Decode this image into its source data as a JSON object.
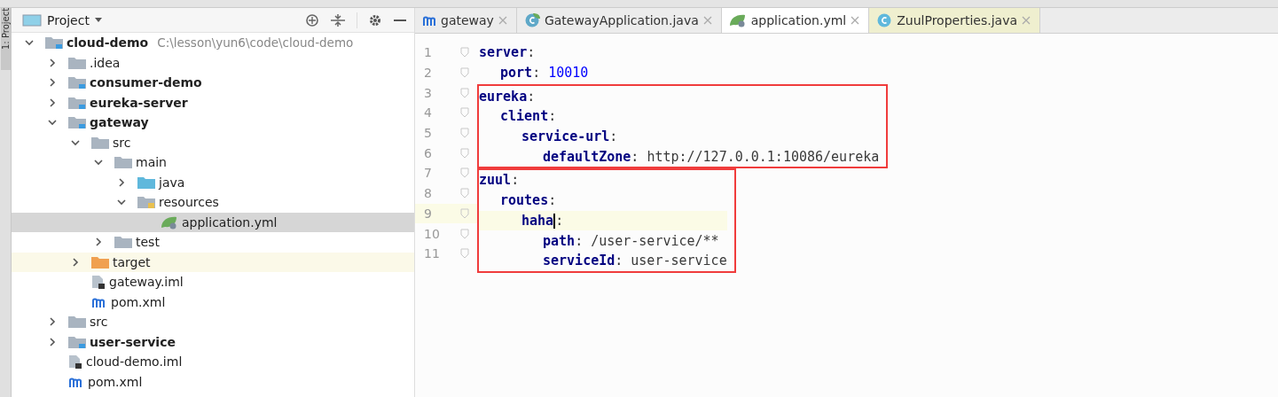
{
  "side_strip": {
    "label": "1: Project"
  },
  "project_panel": {
    "title": "Project",
    "tree": [
      {
        "label": "cloud-demo",
        "path": "C:\\lesson\\yun6\\code\\cloud-demo",
        "kind": "module",
        "expanded": true,
        "selected": false,
        "children": [
          {
            "label": ".idea",
            "kind": "folder",
            "expanded": false,
            "selected": false
          },
          {
            "label": "consumer-demo",
            "kind": "module",
            "expanded": false,
            "selected": false
          },
          {
            "label": "eureka-server",
            "kind": "module",
            "expanded": false,
            "selected": false
          },
          {
            "label": "gateway",
            "kind": "module",
            "expanded": true,
            "selected": false,
            "children": [
              {
                "label": "src",
                "kind": "folder",
                "expanded": true,
                "selected": false,
                "children": [
                  {
                    "label": "main",
                    "kind": "folder",
                    "expanded": true,
                    "selected": false,
                    "children": [
                      {
                        "label": "java",
                        "kind": "source-folder",
                        "expanded": false,
                        "selected": false
                      },
                      {
                        "label": "resources",
                        "kind": "resources-folder",
                        "expanded": true,
                        "selected": false,
                        "children": [
                          {
                            "label": "application.yml",
                            "kind": "spring-file",
                            "selected": true
                          }
                        ]
                      }
                    ]
                  },
                  {
                    "label": "test",
                    "kind": "folder",
                    "expanded": false,
                    "selected": false
                  }
                ]
              },
              {
                "label": "target",
                "kind": "excluded-folder",
                "expanded": false,
                "selected": false
              },
              {
                "label": "gateway.iml",
                "kind": "iml-file",
                "selected": false
              },
              {
                "label": "pom.xml",
                "kind": "maven-file",
                "selected": false
              }
            ]
          },
          {
            "label": "src",
            "kind": "folder",
            "expanded": false,
            "selected": false
          },
          {
            "label": "user-service",
            "kind": "module",
            "expanded": false,
            "selected": false
          },
          {
            "label": "cloud-demo.iml",
            "kind": "iml-file",
            "selected": false
          },
          {
            "label": "pom.xml",
            "kind": "maven-file",
            "selected": false
          }
        ]
      }
    ]
  },
  "editor": {
    "tabs": [
      {
        "label": "gateway",
        "kind": "maven",
        "selected": false
      },
      {
        "label": "GatewayApplication.java",
        "kind": "spring-class",
        "selected": false
      },
      {
        "label": "application.yml",
        "kind": "spring-file",
        "selected": true
      },
      {
        "label": "ZuulProperties.java",
        "kind": "library-class",
        "selected": false
      }
    ],
    "code": [
      {
        "number": "1",
        "key": "server",
        "sep": ":",
        "boxed": false,
        "children": [
          {
            "number": "2",
            "key": "port",
            "sep": ":",
            "value": "10010",
            "kind": "number"
          }
        ]
      },
      {
        "number": "3",
        "key": "eureka",
        "sep": ":",
        "boxed": true,
        "children": [
          {
            "number": "4",
            "key": "client",
            "sep": ":",
            "children": [
              {
                "number": "5",
                "key": "service-url",
                "sep": ":",
                "children": [
                  {
                    "number": "6",
                    "key": "defaultZone",
                    "sep": ":",
                    "value": "http://127.0.0.1:10086/eureka",
                    "kind": "string"
                  }
                ]
              }
            ]
          }
        ]
      },
      {
        "number": "7",
        "key": "zuul",
        "sep": ":",
        "boxed": true,
        "children": [
          {
            "number": "8",
            "key": "routes",
            "sep": ":",
            "children": [
              {
                "number": "9",
                "key": "haha",
                "sep": ":",
                "cursor": true,
                "children": [
                  {
                    "number": "10",
                    "key": "path",
                    "sep": ":",
                    "value": "/user-service/**",
                    "kind": "string"
                  },
                  {
                    "number": "11",
                    "key": "serviceId",
                    "sep": ":",
                    "value": "user-service",
                    "kind": "string"
                  }
                ]
              }
            ]
          }
        ]
      }
    ]
  }
}
